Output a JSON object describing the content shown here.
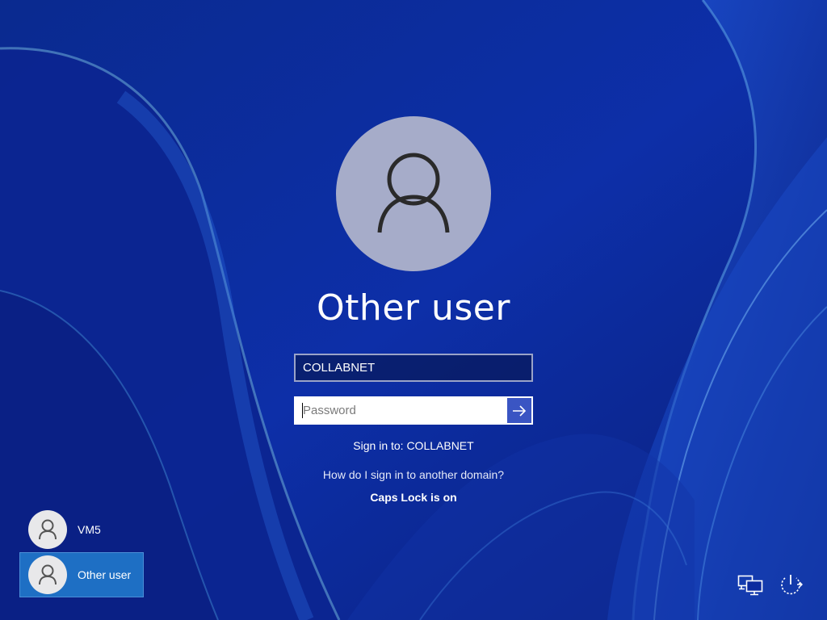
{
  "login": {
    "display_name": "Other user",
    "domain_value": "COLLABNET",
    "password_placeholder": "Password",
    "sign_in_to": "Sign in to: COLLABNET",
    "other_domain_link": "How do I sign in to another domain?",
    "caps_lock_notice": "Caps Lock is on"
  },
  "user_list": [
    {
      "name": "VM5",
      "selected": false
    },
    {
      "name": "Other user",
      "selected": true
    }
  ],
  "icons": {
    "large_avatar": "user-avatar-icon",
    "submit": "arrow-right-icon",
    "network": "network-icon",
    "power": "power-icon"
  },
  "colors": {
    "background": "#0b2a9e",
    "avatar_bg": "#a6acc9",
    "submit_bg": "#3a55c3",
    "selected_user_bg": "#1e6fc4"
  }
}
